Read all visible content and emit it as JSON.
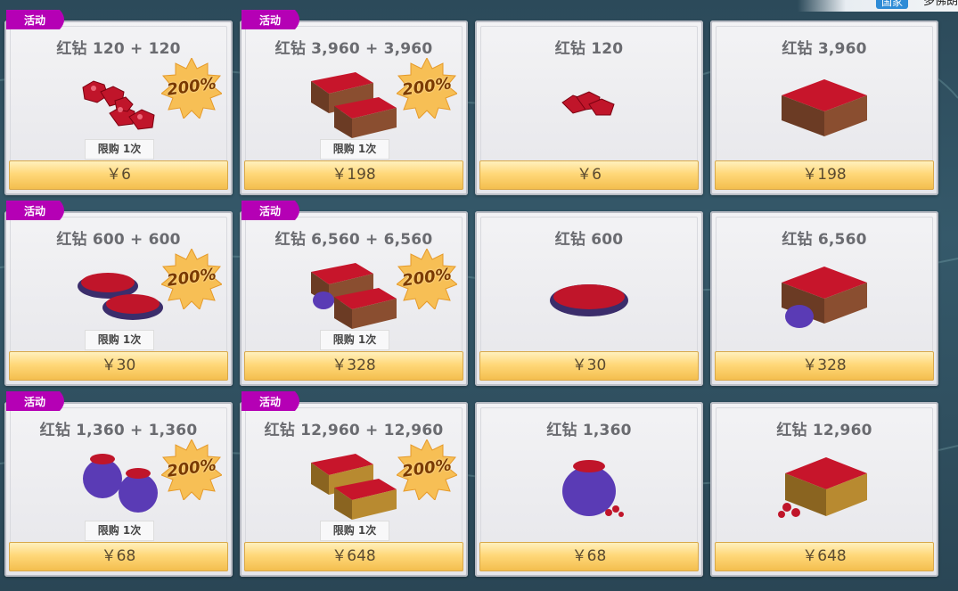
{
  "top": {
    "tag": "国家",
    "text": "多佛朗"
  },
  "labels": {
    "event": "活动",
    "burst": "200%",
    "limit": "限购 1次"
  },
  "colors": {
    "event": "#b500b5",
    "burst": "#f7bf55",
    "button": "#ffd879"
  },
  "cards": [
    {
      "title": "红钻 120 + 120",
      "price": "￥6",
      "event": true,
      "art": "gems-double"
    },
    {
      "title": "红钻 3,960 + 3,960",
      "price": "￥198",
      "event": true,
      "art": "chest-double"
    },
    {
      "title": "红钻 120",
      "price": "￥6",
      "event": false,
      "art": "gems-small"
    },
    {
      "title": "红钻 3,960",
      "price": "￥198",
      "event": false,
      "art": "chest"
    },
    {
      "title": "红钻 600 + 600",
      "price": "￥30",
      "event": true,
      "art": "plate-double"
    },
    {
      "title": "红钻 6,560 + 6,560",
      "price": "￥328",
      "event": true,
      "art": "chest-bag-double"
    },
    {
      "title": "红钻 600",
      "price": "￥30",
      "event": false,
      "art": "plate"
    },
    {
      "title": "红钻 6,560",
      "price": "￥328",
      "event": false,
      "art": "chest-bag"
    },
    {
      "title": "红钻 1,360 + 1,360",
      "price": "￥68",
      "event": true,
      "art": "bag-double"
    },
    {
      "title": "红钻 12,960 + 12,960",
      "price": "￥648",
      "event": true,
      "art": "gold-chest-double"
    },
    {
      "title": "红钻 1,360",
      "price": "￥68",
      "event": false,
      "art": "bag"
    },
    {
      "title": "红钻 12,960",
      "price": "￥648",
      "event": false,
      "art": "gold-chest"
    }
  ]
}
